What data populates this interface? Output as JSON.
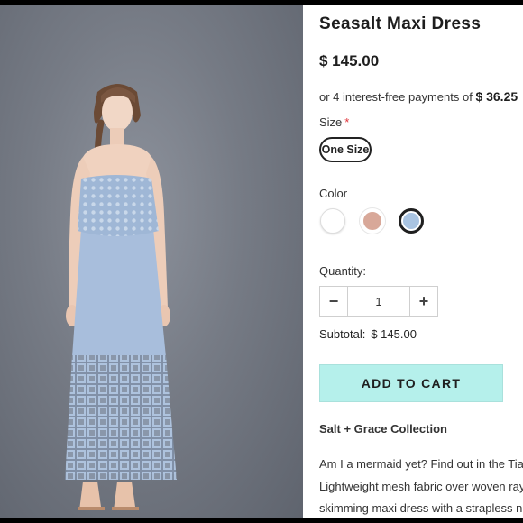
{
  "product": {
    "title": "Seasalt Maxi Dress",
    "price": "$ 145.00",
    "installments_text": "or 4 interest-free payments of",
    "installment_amount": "$ 36.25"
  },
  "size": {
    "label": "Size",
    "required_marker": "*",
    "options": [
      "One Size"
    ]
  },
  "color": {
    "label": "Color",
    "swatches": [
      "#ffffff",
      "#d8a899",
      "#a9c4e2"
    ],
    "selected_index": 2
  },
  "quantity": {
    "label": "Quantity:",
    "value": "1",
    "decrement": "−",
    "increment": "+"
  },
  "subtotal": {
    "label": "Subtotal:",
    "value": "$ 145.00"
  },
  "cart": {
    "button_label": "ADD TO CART"
  },
  "collection": "Salt + Grace Collection",
  "description_lines": [
    "Am I a mermaid yet? Find out in the Tian",
    "Lightweight mesh fabric over woven rayo",
    "skimming maxi dress with a strapless ne"
  ],
  "colors": {
    "accent": "#b5f0eb",
    "required": "#e0343a",
    "dress": "#a9c4e2"
  }
}
